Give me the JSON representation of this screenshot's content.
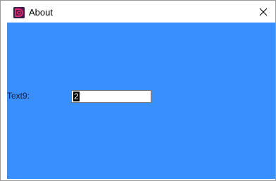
{
  "window": {
    "title": "About",
    "app_icon": "app-logo-icon",
    "close_icon": "close-icon"
  },
  "form": {
    "text9_label": "Text9:",
    "text9_value": "2"
  },
  "colors": {
    "client_background": "#3a8ffe",
    "titlebar_background": "#ffffff",
    "textbox_background": "#ffffff",
    "selection_background": "#000000"
  }
}
